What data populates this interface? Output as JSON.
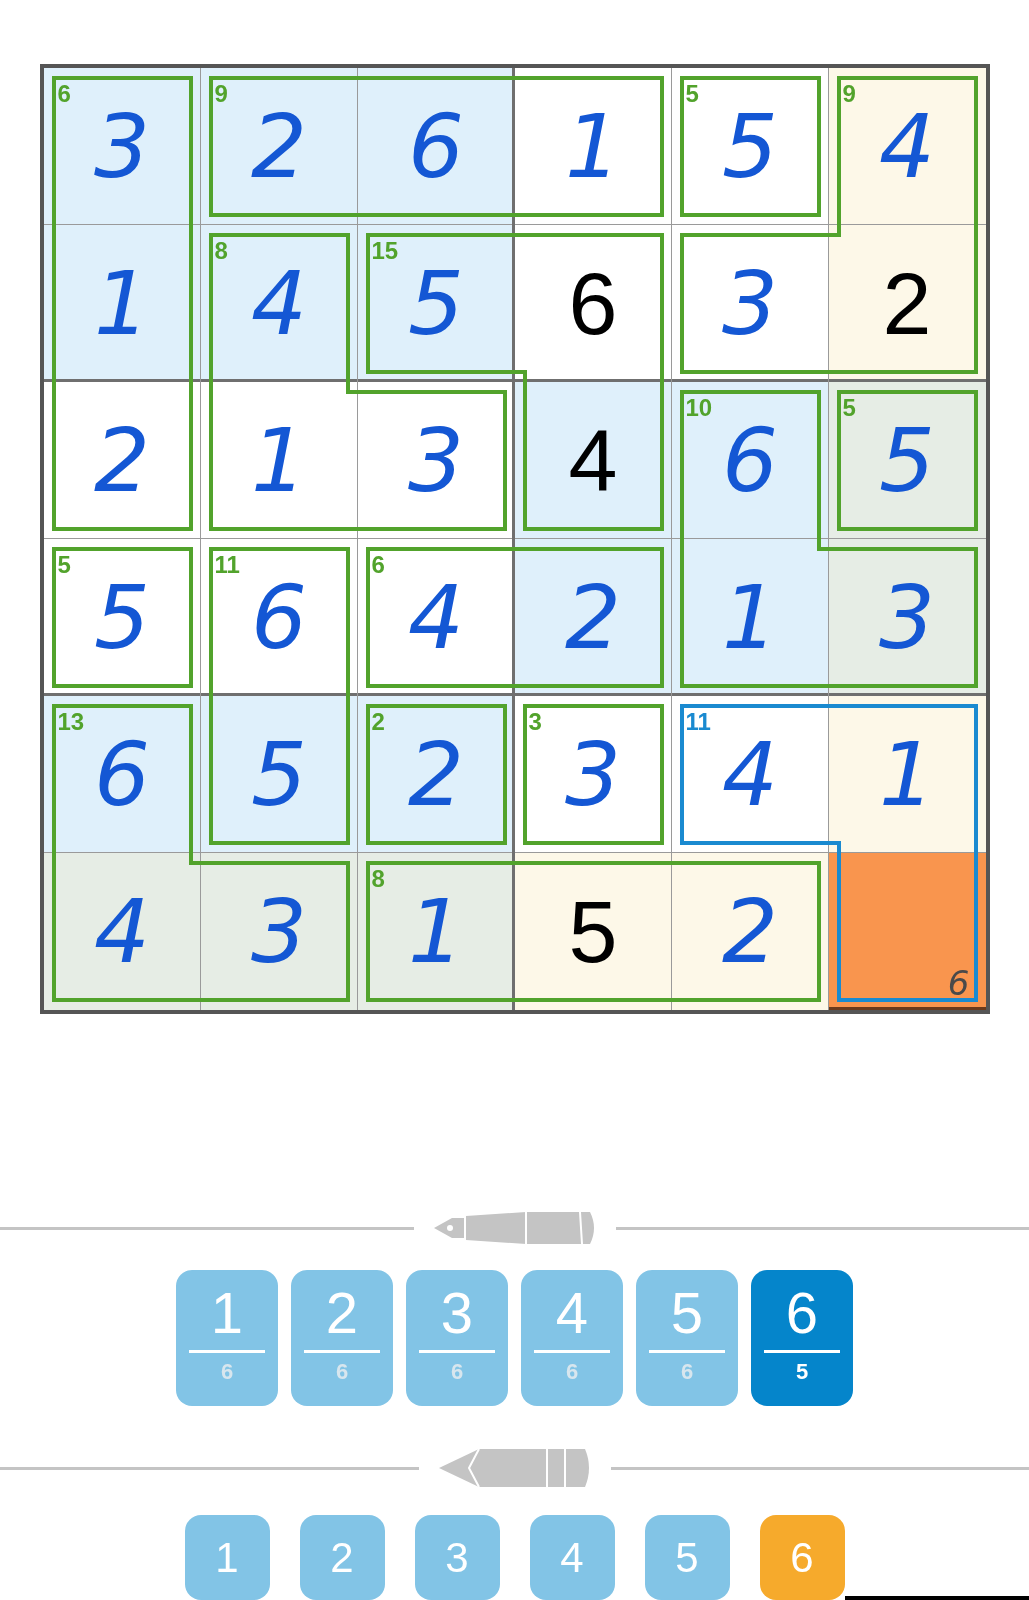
{
  "grid": {
    "rows": [
      {
        "cells": [
          {
            "value": "3",
            "given": false,
            "color": "#dff0fb",
            "cage_sum": "6",
            "cage_selected": false,
            "walls": {
              "top": true,
              "right": true,
              "left": true
            }
          },
          {
            "value": "2",
            "given": false,
            "color": "#dff0fb",
            "cage_sum": "9",
            "cage_selected": false,
            "walls": {
              "top": true,
              "bottom": true,
              "left": true
            }
          },
          {
            "value": "6",
            "given": false,
            "color": "#dff0fb",
            "cage_selected": false,
            "walls": {
              "top": true,
              "bottom": true
            }
          },
          {
            "value": "1",
            "given": false,
            "color": "#ffffff",
            "cage_selected": false,
            "walls": {
              "top": true,
              "right": true,
              "bottom": true
            }
          },
          {
            "value": "5",
            "given": false,
            "color": "#ffffff",
            "cage_sum": "5",
            "cage_selected": false,
            "walls": {
              "top": true,
              "right": true,
              "bottom": true,
              "left": true
            }
          },
          {
            "value": "4",
            "given": false,
            "color": "#fdf8e8",
            "cage_sum": "9",
            "cage_selected": false,
            "walls": {
              "top": true,
              "right": true,
              "left": true
            }
          }
        ]
      },
      {
        "cells": [
          {
            "value": "1",
            "given": false,
            "color": "#dff0fb",
            "cage_selected": false,
            "walls": {
              "right": true,
              "left": true
            }
          },
          {
            "value": "4",
            "given": false,
            "color": "#dff0fb",
            "cage_sum": "8",
            "cage_selected": false,
            "walls": {
              "top": true,
              "right": true,
              "left": true
            }
          },
          {
            "value": "5",
            "given": false,
            "color": "#dff0fb",
            "cage_sum": "15",
            "cage_selected": false,
            "walls": {
              "top": true,
              "bottom": true,
              "left": true
            }
          },
          {
            "value": "6",
            "given": true,
            "color": "#ffffff",
            "cage_selected": false,
            "walls": {
              "top": true,
              "right": true
            }
          },
          {
            "value": "3",
            "given": false,
            "color": "#ffffff",
            "cage_selected": false,
            "walls": {
              "top": true,
              "bottom": true,
              "left": true
            }
          },
          {
            "value": "2",
            "given": true,
            "color": "#fdf8e8",
            "cage_selected": false,
            "walls": {
              "right": true,
              "bottom": true
            }
          }
        ]
      },
      {
        "cells": [
          {
            "value": "2",
            "given": false,
            "color": "#ffffff",
            "cage_selected": false,
            "walls": {
              "right": true,
              "bottom": true,
              "left": true
            }
          },
          {
            "value": "1",
            "given": false,
            "color": "#ffffff",
            "cage_selected": false,
            "walls": {
              "bottom": true,
              "left": true
            }
          },
          {
            "value": "3",
            "given": false,
            "color": "#ffffff",
            "cage_selected": false,
            "walls": {
              "top": true,
              "right": true,
              "bottom": true
            }
          },
          {
            "value": "4",
            "given": true,
            "color": "#dff0fb",
            "cage_selected": false,
            "walls": {
              "right": true,
              "bottom": true,
              "left": true
            }
          },
          {
            "value": "6",
            "given": false,
            "color": "#dff0fb",
            "cage_sum": "10",
            "cage_selected": false,
            "walls": {
              "top": true,
              "right": true,
              "left": true
            }
          },
          {
            "value": "5",
            "given": false,
            "color": "#e6ede5",
            "cage_sum": "5",
            "cage_selected": false,
            "walls": {
              "top": true,
              "right": true,
              "bottom": true,
              "left": true
            }
          }
        ]
      },
      {
        "cells": [
          {
            "value": "5",
            "given": false,
            "color": "#ffffff",
            "cage_sum": "5",
            "cage_selected": false,
            "walls": {
              "top": true,
              "right": true,
              "bottom": true,
              "left": true
            }
          },
          {
            "value": "6",
            "given": false,
            "color": "#ffffff",
            "cage_sum": "11",
            "cage_selected": false,
            "walls": {
              "top": true,
              "right": true,
              "left": true
            }
          },
          {
            "value": "4",
            "given": false,
            "color": "#ffffff",
            "cage_sum": "6",
            "cage_selected": false,
            "walls": {
              "top": true,
              "bottom": true,
              "left": true
            }
          },
          {
            "value": "2",
            "given": false,
            "color": "#dff0fb",
            "cage_selected": false,
            "walls": {
              "top": true,
              "right": true,
              "bottom": true
            }
          },
          {
            "value": "1",
            "given": false,
            "color": "#dff0fb",
            "cage_selected": false,
            "walls": {
              "bottom": true,
              "left": true
            }
          },
          {
            "value": "3",
            "given": false,
            "color": "#e6ede5",
            "cage_selected": false,
            "walls": {
              "top": true,
              "right": true,
              "bottom": true
            }
          }
        ]
      },
      {
        "cells": [
          {
            "value": "6",
            "given": false,
            "color": "#dff0fb",
            "cage_sum": "13",
            "cage_selected": false,
            "walls": {
              "top": true,
              "right": true,
              "left": true
            }
          },
          {
            "value": "5",
            "given": false,
            "color": "#dff0fb",
            "cage_selected": false,
            "walls": {
              "right": true,
              "bottom": true,
              "left": true
            }
          },
          {
            "value": "2",
            "given": false,
            "color": "#dff0fb",
            "cage_sum": "2",
            "cage_selected": false,
            "walls": {
              "top": true,
              "right": true,
              "bottom": true,
              "left": true
            }
          },
          {
            "value": "3",
            "given": false,
            "color": "#ffffff",
            "cage_sum": "3",
            "cage_selected": false,
            "walls": {
              "top": true,
              "right": true,
              "bottom": true,
              "left": true
            }
          },
          {
            "value": "4",
            "given": false,
            "color": "#ffffff",
            "cage_sum": "11",
            "cage_selected": true,
            "walls": {
              "top": true,
              "bottom": true,
              "left": true
            }
          },
          {
            "value": "1",
            "given": false,
            "color": "#fdf8e8",
            "cage_selected": true,
            "walls": {
              "top": true,
              "right": true
            }
          }
        ]
      },
      {
        "cells": [
          {
            "value": "4",
            "given": false,
            "color": "#e6ede5",
            "cage_selected": false,
            "walls": {
              "bottom": true,
              "left": true
            }
          },
          {
            "value": "3",
            "given": false,
            "color": "#e6ede5",
            "cage_selected": false,
            "walls": {
              "top": true,
              "right": true,
              "bottom": true
            }
          },
          {
            "value": "1",
            "given": false,
            "color": "#e6ede5",
            "cage_sum": "8",
            "cage_selected": false,
            "walls": {
              "top": true,
              "bottom": true,
              "left": true
            }
          },
          {
            "value": "5",
            "given": true,
            "color": "#fdf8e8",
            "cage_selected": false,
            "walls": {
              "top": true,
              "bottom": true
            }
          },
          {
            "value": "2",
            "given": false,
            "color": "#fdf8e8",
            "cage_selected": false,
            "walls": {
              "top": true,
              "right": true,
              "bottom": true
            }
          },
          {
            "note": "6",
            "selected": true,
            "color": "#f9954e",
            "cage_selected": true,
            "walls": {
              "right": true,
              "bottom": true,
              "left": true
            }
          }
        ]
      }
    ]
  },
  "pen_buttons": [
    {
      "digit": "1",
      "count": "6",
      "selected": false
    },
    {
      "digit": "2",
      "count": "6",
      "selected": false
    },
    {
      "digit": "3",
      "count": "6",
      "selected": false
    },
    {
      "digit": "4",
      "count": "6",
      "selected": false
    },
    {
      "digit": "5",
      "count": "6",
      "selected": false
    },
    {
      "digit": "6",
      "count": "5",
      "selected": true
    }
  ],
  "pencil_buttons": [
    {
      "digit": "1",
      "selected": false
    },
    {
      "digit": "2",
      "selected": false
    },
    {
      "digit": "3",
      "selected": false
    },
    {
      "digit": "4",
      "selected": false
    },
    {
      "digit": "5",
      "selected": false
    },
    {
      "digit": "6",
      "selected": true
    }
  ]
}
